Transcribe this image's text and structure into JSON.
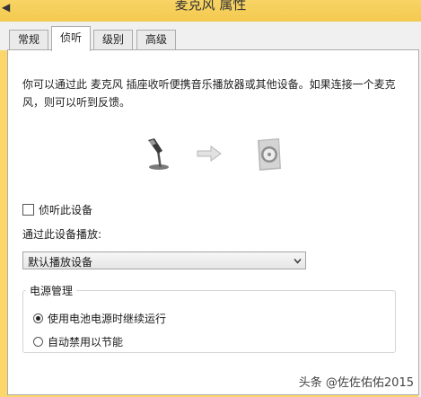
{
  "window": {
    "title": "麦克风 属性",
    "system_icon": "speaker-small-icon"
  },
  "tabs": [
    {
      "label": "常规",
      "active": false
    },
    {
      "label": "侦听",
      "active": true
    },
    {
      "label": "级别",
      "active": false
    },
    {
      "label": "高级",
      "active": false
    }
  ],
  "listen": {
    "description": "你可以通过此 麦克风 插座收听便携音乐播放器或其他设备。如果连接一个麦克风，则可以听到反馈。",
    "icons": [
      "microphone-icon",
      "arrow-right-icon",
      "speaker-icon"
    ],
    "listen_checkbox_label": "侦听此设备",
    "listen_checked": false,
    "playback_label": "通过此设备播放:",
    "playback_selected": "默认播放设备"
  },
  "power": {
    "group_title": "电源管理",
    "options": [
      {
        "label": "使用电池电源时继续运行",
        "selected": true
      },
      {
        "label": "自动禁用以节能",
        "selected": false
      }
    ]
  },
  "watermark": "头条 @佐佐佑佑2015"
}
